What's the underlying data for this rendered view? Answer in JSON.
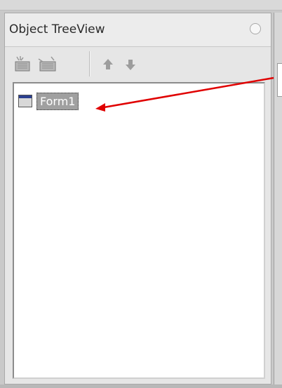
{
  "panel": {
    "title": "Object TreeView",
    "toolbar": {
      "buttons": [
        {
          "name": "add-icon"
        },
        {
          "name": "remove-icon"
        },
        {
          "name": "move-up-icon"
        },
        {
          "name": "move-down-icon"
        }
      ]
    },
    "tree": {
      "items": [
        {
          "label": "Form1",
          "selected": true,
          "icon": "form-icon"
        }
      ]
    }
  },
  "annotation": {
    "color": "#e00000"
  }
}
